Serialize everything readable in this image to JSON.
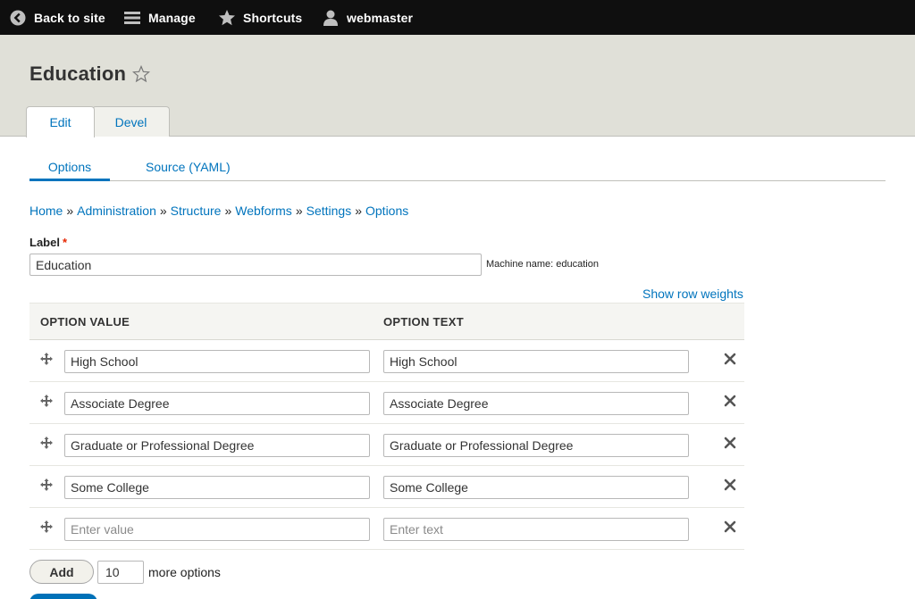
{
  "toolbar": {
    "back_label": "Back to site",
    "manage_label": "Manage",
    "shortcuts_label": "Shortcuts",
    "user_label": "webmaster"
  },
  "page": {
    "title": "Education"
  },
  "primary_tabs": [
    {
      "label": "Edit",
      "active": true
    },
    {
      "label": "Devel",
      "active": false
    }
  ],
  "secondary_tabs": [
    {
      "label": "Options",
      "active": true
    },
    {
      "label": "Source (YAML)",
      "active": false
    }
  ],
  "breadcrumb": [
    "Home",
    "Administration",
    "Structure",
    "Webforms",
    "Settings",
    "Options"
  ],
  "breadcrumb_separator": "»",
  "form": {
    "label_title": "Label",
    "required_marker": "*",
    "label_value": "Education",
    "machine_name": "Machine name: education",
    "show_row_weights": "Show row weights"
  },
  "table": {
    "headers": {
      "value": "OPTION VALUE",
      "text": "OPTION TEXT"
    },
    "rows": [
      {
        "value": "High School",
        "text": "High School"
      },
      {
        "value": "Associate Degree",
        "text": "Associate Degree"
      },
      {
        "value": "Graduate or Professional Degree",
        "text": "Graduate or Professional Degree"
      },
      {
        "value": "Some College",
        "text": "Some College"
      },
      {
        "value": "",
        "text": "",
        "value_placeholder": "Enter value",
        "text_placeholder": "Enter text"
      }
    ]
  },
  "add": {
    "button_label": "Add",
    "count": "10",
    "suffix": "more options"
  },
  "colors": {
    "link": "#0074bd",
    "toolbar_bg": "#0f0f0f",
    "header_bg": "#e0e0d8",
    "required": "#e62600",
    "primary_button": "#0071b8"
  }
}
